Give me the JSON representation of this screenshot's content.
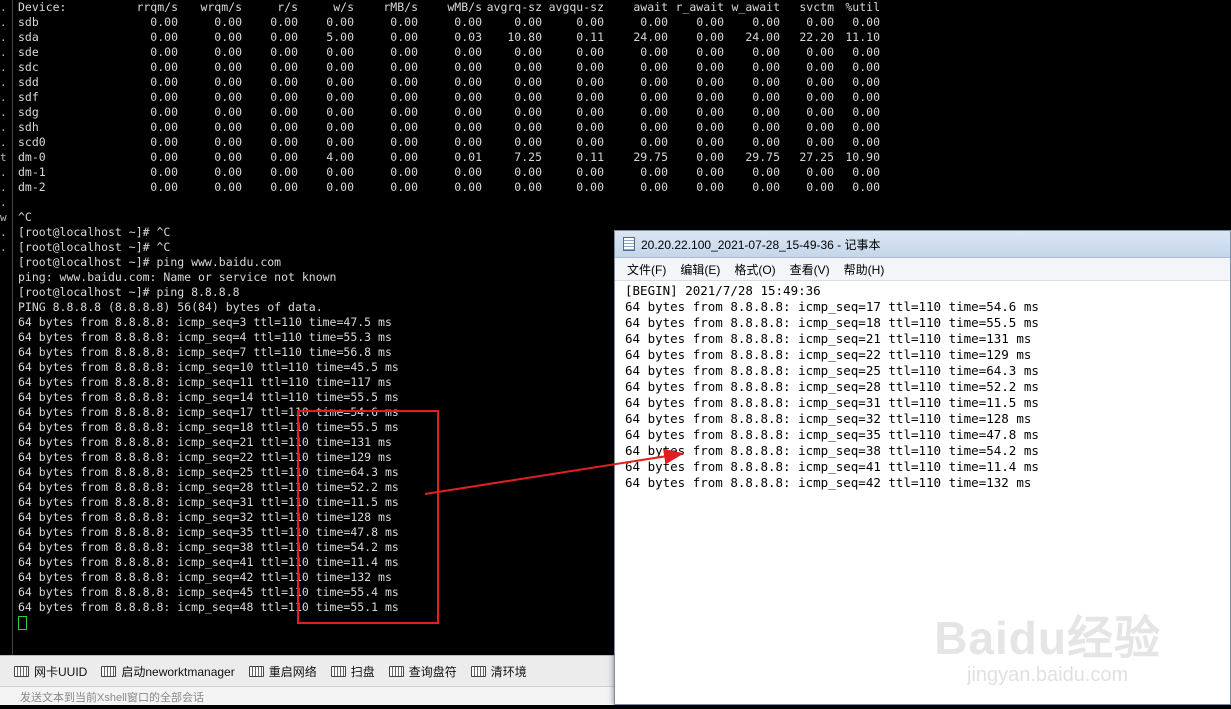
{
  "gutter_chars": [
    ".",
    ".",
    ".",
    ".",
    ".",
    ".",
    ".",
    ".",
    ".",
    ".",
    "t",
    ".",
    ".",
    ".",
    "w",
    ".",
    "."
  ],
  "iostat": {
    "header": [
      "Device:",
      "rrqm/s",
      "wrqm/s",
      "r/s",
      "w/s",
      "rMB/s",
      "wMB/s",
      "avgrq-sz",
      "avgqu-sz",
      "await",
      "r_await",
      "w_await",
      "svctm",
      "%util"
    ],
    "rows": [
      [
        "sdb",
        "0.00",
        "0.00",
        "0.00",
        "0.00",
        "0.00",
        "0.00",
        "0.00",
        "0.00",
        "0.00",
        "0.00",
        "0.00",
        "0.00",
        "0.00"
      ],
      [
        "sda",
        "0.00",
        "0.00",
        "0.00",
        "5.00",
        "0.00",
        "0.03",
        "10.80",
        "0.11",
        "24.00",
        "0.00",
        "24.00",
        "22.20",
        "11.10"
      ],
      [
        "sde",
        "0.00",
        "0.00",
        "0.00",
        "0.00",
        "0.00",
        "0.00",
        "0.00",
        "0.00",
        "0.00",
        "0.00",
        "0.00",
        "0.00",
        "0.00"
      ],
      [
        "sdc",
        "0.00",
        "0.00",
        "0.00",
        "0.00",
        "0.00",
        "0.00",
        "0.00",
        "0.00",
        "0.00",
        "0.00",
        "0.00",
        "0.00",
        "0.00"
      ],
      [
        "sdd",
        "0.00",
        "0.00",
        "0.00",
        "0.00",
        "0.00",
        "0.00",
        "0.00",
        "0.00",
        "0.00",
        "0.00",
        "0.00",
        "0.00",
        "0.00"
      ],
      [
        "sdf",
        "0.00",
        "0.00",
        "0.00",
        "0.00",
        "0.00",
        "0.00",
        "0.00",
        "0.00",
        "0.00",
        "0.00",
        "0.00",
        "0.00",
        "0.00"
      ],
      [
        "sdg",
        "0.00",
        "0.00",
        "0.00",
        "0.00",
        "0.00",
        "0.00",
        "0.00",
        "0.00",
        "0.00",
        "0.00",
        "0.00",
        "0.00",
        "0.00"
      ],
      [
        "sdh",
        "0.00",
        "0.00",
        "0.00",
        "0.00",
        "0.00",
        "0.00",
        "0.00",
        "0.00",
        "0.00",
        "0.00",
        "0.00",
        "0.00",
        "0.00"
      ],
      [
        "scd0",
        "0.00",
        "0.00",
        "0.00",
        "0.00",
        "0.00",
        "0.00",
        "0.00",
        "0.00",
        "0.00",
        "0.00",
        "0.00",
        "0.00",
        "0.00"
      ],
      [
        "dm-0",
        "0.00",
        "0.00",
        "0.00",
        "4.00",
        "0.00",
        "0.01",
        "7.25",
        "0.11",
        "29.75",
        "0.00",
        "29.75",
        "27.25",
        "10.90"
      ],
      [
        "dm-1",
        "0.00",
        "0.00",
        "0.00",
        "0.00",
        "0.00",
        "0.00",
        "0.00",
        "0.00",
        "0.00",
        "0.00",
        "0.00",
        "0.00",
        "0.00"
      ],
      [
        "dm-2",
        "0.00",
        "0.00",
        "0.00",
        "0.00",
        "0.00",
        "0.00",
        "0.00",
        "0.00",
        "0.00",
        "0.00",
        "0.00",
        "0.00",
        "0.00"
      ]
    ]
  },
  "terminal_lines": [
    "",
    "^C",
    "[root@localhost ~]# ^C",
    "[root@localhost ~]# ^C",
    "[root@localhost ~]# ping www.baidu.com",
    "ping: www.baidu.com: Name or service not known",
    "[root@localhost ~]# ping 8.8.8.8",
    "PING 8.8.8.8 (8.8.8.8) 56(84) bytes of data.",
    "64 bytes from 8.8.8.8: icmp_seq=3 ttl=110 time=47.5 ms",
    "64 bytes from 8.8.8.8: icmp_seq=4 ttl=110 time=55.3 ms",
    "64 bytes from 8.8.8.8: icmp_seq=7 ttl=110 time=56.8 ms",
    "64 bytes from 8.8.8.8: icmp_seq=10 ttl=110 time=45.5 ms",
    "64 bytes from 8.8.8.8: icmp_seq=11 ttl=110 time=117 ms",
    "64 bytes from 8.8.8.8: icmp_seq=14 ttl=110 time=55.5 ms",
    "64 bytes from 8.8.8.8: icmp_seq=17 ttl=110 time=54.6 ms",
    "64 bytes from 8.8.8.8: icmp_seq=18 ttl=110 time=55.5 ms",
    "64 bytes from 8.8.8.8: icmp_seq=21 ttl=110 time=131 ms",
    "64 bytes from 8.8.8.8: icmp_seq=22 ttl=110 time=129 ms",
    "64 bytes from 8.8.8.8: icmp_seq=25 ttl=110 time=64.3 ms",
    "64 bytes from 8.8.8.8: icmp_seq=28 ttl=110 time=52.2 ms",
    "64 bytes from 8.8.8.8: icmp_seq=31 ttl=110 time=11.5 ms",
    "64 bytes from 8.8.8.8: icmp_seq=32 ttl=110 time=128 ms",
    "64 bytes from 8.8.8.8: icmp_seq=35 ttl=110 time=47.8 ms",
    "64 bytes from 8.8.8.8: icmp_seq=38 ttl=110 time=54.2 ms",
    "64 bytes from 8.8.8.8: icmp_seq=41 ttl=110 time=11.4 ms",
    "64 bytes from 8.8.8.8: icmp_seq=42 ttl=110 time=132 ms",
    "64 bytes from 8.8.8.8: icmp_seq=45 ttl=110 time=55.4 ms",
    "64 bytes from 8.8.8.8: icmp_seq=48 ttl=110 time=55.1 ms"
  ],
  "toolbar": {
    "buttons": [
      "网卡UUID",
      "启动neworktmanager",
      "重启网络",
      "扫盘",
      "查询盘符",
      "清环境"
    ]
  },
  "statusbar": {
    "text": "发送文本到当前Xshell窗口的全部会话"
  },
  "notepad": {
    "title": "20.20.22.100_2021-07-28_15-49-36 - 记事本",
    "menu": [
      "文件(F)",
      "编辑(E)",
      "格式(O)",
      "查看(V)",
      "帮助(H)"
    ],
    "lines": [
      "[BEGIN] 2021/7/28 15:49:36",
      "64 bytes from 8.8.8.8: icmp_seq=17 ttl=110 time=54.6 ms",
      "64 bytes from 8.8.8.8: icmp_seq=18 ttl=110 time=55.5 ms",
      "64 bytes from 8.8.8.8: icmp_seq=21 ttl=110 time=131 ms",
      "64 bytes from 8.8.8.8: icmp_seq=22 ttl=110 time=129 ms",
      "64 bytes from 8.8.8.8: icmp_seq=25 ttl=110 time=64.3 ms",
      "64 bytes from 8.8.8.8: icmp_seq=28 ttl=110 time=52.2 ms",
      "64 bytes from 8.8.8.8: icmp_seq=31 ttl=110 time=11.5 ms",
      "64 bytes from 8.8.8.8: icmp_seq=32 ttl=110 time=128 ms",
      "64 bytes from 8.8.8.8: icmp_seq=35 ttl=110 time=47.8 ms",
      "64 bytes from 8.8.8.8: icmp_seq=38 ttl=110 time=54.2 ms",
      "64 bytes from 8.8.8.8: icmp_seq=41 ttl=110 time=11.4 ms",
      "64 bytes from 8.8.8.8: icmp_seq=42 ttl=110 time=132 ms"
    ]
  },
  "watermark": {
    "logo": "Baidu经验",
    "sub": "jingyan.baidu.com"
  },
  "colors": {
    "annotation_red": "#e02020",
    "cursor_green": "#2ecc40"
  }
}
